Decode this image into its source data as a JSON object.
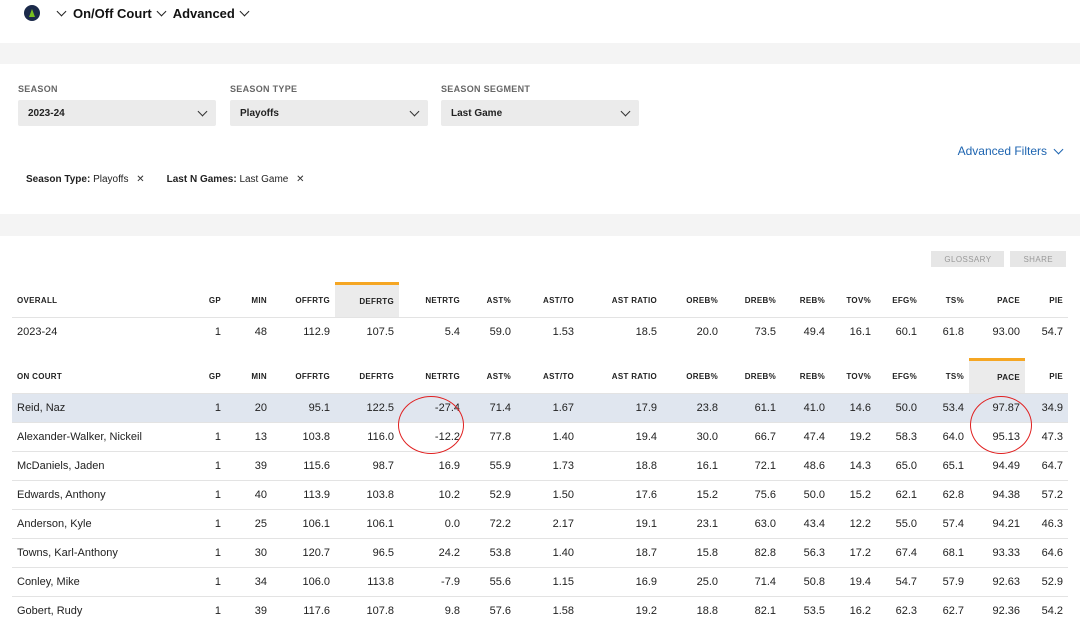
{
  "nav": {
    "team_logo": "timberwolves-logo",
    "item1": "On/Off Court",
    "item2": "Advanced"
  },
  "filters": {
    "season": {
      "label": "SEASON",
      "value": "2023-24"
    },
    "season_type": {
      "label": "SEASON TYPE",
      "value": "Playoffs"
    },
    "season_segment": {
      "label": "SEASON SEGMENT",
      "value": "Last Game"
    },
    "advanced_filters": "Advanced Filters",
    "chips": [
      {
        "key": "Season Type:",
        "value": "Playoffs",
        "x": "✕"
      },
      {
        "key": "Last N Games:",
        "value": "Last Game",
        "x": "✕"
      }
    ]
  },
  "buttons": {
    "glossary": "GLOSSARY",
    "share": "SHARE"
  },
  "overall": {
    "headers": [
      "OVERALL",
      "GP",
      "MIN",
      "OFFRTG",
      "DEFRTG",
      "NETRTG",
      "AST%",
      "AST/TO",
      "AST RATIO",
      "OREB%",
      "DREB%",
      "REB%",
      "TOV%",
      "EFG%",
      "TS%",
      "PACE",
      "PIE"
    ],
    "row": [
      "2023-24",
      "1",
      "48",
      "112.9",
      "107.5",
      "5.4",
      "59.0",
      "1.53",
      "18.5",
      "20.0",
      "73.5",
      "49.4",
      "16.1",
      "60.1",
      "61.8",
      "93.00",
      "54.7"
    ]
  },
  "on_court": {
    "headers": [
      "ON COURT",
      "GP",
      "MIN",
      "OFFRTG",
      "DEFRTG",
      "NETRTG",
      "AST%",
      "AST/TO",
      "AST RATIO",
      "OREB%",
      "DREB%",
      "REB%",
      "TOV%",
      "EFG%",
      "TS%",
      "PACE",
      "PIE"
    ],
    "rows": [
      [
        "Reid, Naz",
        "1",
        "20",
        "95.1",
        "122.5",
        "-27.4",
        "71.4",
        "1.67",
        "17.9",
        "23.8",
        "61.1",
        "41.0",
        "14.6",
        "50.0",
        "53.4",
        "97.87",
        "34.9"
      ],
      [
        "Alexander-Walker, Nickeil",
        "1",
        "13",
        "103.8",
        "116.0",
        "-12.2",
        "77.8",
        "1.40",
        "19.4",
        "30.0",
        "66.7",
        "47.4",
        "19.2",
        "58.3",
        "64.0",
        "95.13",
        "47.3"
      ],
      [
        "McDaniels, Jaden",
        "1",
        "39",
        "115.6",
        "98.7",
        "16.9",
        "55.9",
        "1.73",
        "18.8",
        "16.1",
        "72.1",
        "48.6",
        "14.3",
        "65.0",
        "65.1",
        "94.49",
        "64.7"
      ],
      [
        "Edwards, Anthony",
        "1",
        "40",
        "113.9",
        "103.8",
        "10.2",
        "52.9",
        "1.50",
        "17.6",
        "15.2",
        "75.6",
        "50.0",
        "15.2",
        "62.1",
        "62.8",
        "94.38",
        "57.2"
      ],
      [
        "Anderson, Kyle",
        "1",
        "25",
        "106.1",
        "106.1",
        "0.0",
        "72.2",
        "2.17",
        "19.1",
        "23.1",
        "63.0",
        "43.4",
        "12.2",
        "55.0",
        "57.4",
        "94.21",
        "46.3"
      ],
      [
        "Towns, Karl-Anthony",
        "1",
        "30",
        "120.7",
        "96.5",
        "24.2",
        "53.8",
        "1.40",
        "18.7",
        "15.8",
        "82.8",
        "56.3",
        "17.2",
        "67.4",
        "68.1",
        "93.33",
        "64.6"
      ],
      [
        "Conley, Mike",
        "1",
        "34",
        "106.0",
        "113.8",
        "-7.9",
        "55.6",
        "1.15",
        "16.9",
        "25.0",
        "71.4",
        "50.8",
        "19.4",
        "54.7",
        "57.9",
        "92.63",
        "52.9"
      ],
      [
        "Gobert, Rudy",
        "1",
        "39",
        "117.6",
        "107.8",
        "9.8",
        "57.6",
        "1.58",
        "19.2",
        "18.8",
        "82.1",
        "53.5",
        "16.2",
        "62.3",
        "62.7",
        "92.36",
        "54.2"
      ]
    ]
  }
}
